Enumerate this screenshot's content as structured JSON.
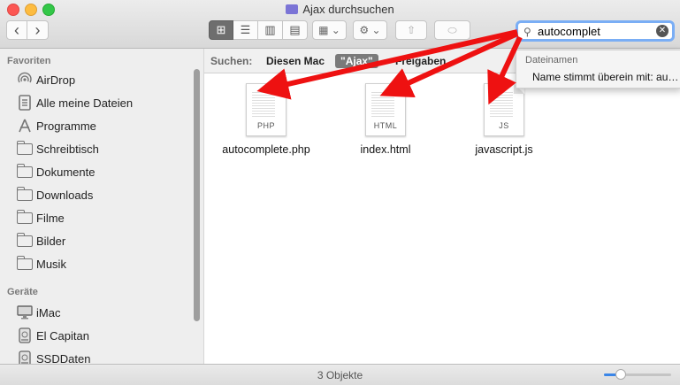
{
  "window": {
    "title": "Ajax durchsuchen",
    "search_value": "autocomplet"
  },
  "toolbar": {
    "back_glyph": "‹",
    "forward_glyph": "›",
    "view_icon_glyph": "⊞",
    "view_list_glyph": "☰",
    "view_column_glyph": "▥",
    "view_gallery_glyph": "▤",
    "arrange_glyph": "▦ ⌄",
    "action_glyph": "⚙ ⌄",
    "share_glyph": "⇧",
    "tag_glyph": "⬭",
    "search_glyph": "⚲",
    "clear_glyph": "✕"
  },
  "sidebar": {
    "favorites_header": "Favoriten",
    "favorites": [
      {
        "label": "AirDrop",
        "icon": "airdrop-icon"
      },
      {
        "label": "Alle meine Dateien",
        "icon": "all-files-icon"
      },
      {
        "label": "Programme",
        "icon": "applications-icon"
      },
      {
        "label": "Schreibtisch",
        "icon": "folder-icon"
      },
      {
        "label": "Dokumente",
        "icon": "folder-icon"
      },
      {
        "label": "Downloads",
        "icon": "folder-icon"
      },
      {
        "label": "Filme",
        "icon": "folder-icon"
      },
      {
        "label": "Bilder",
        "icon": "folder-icon"
      },
      {
        "label": "Musik",
        "icon": "folder-icon"
      }
    ],
    "devices_header": "Geräte",
    "devices": [
      {
        "label": "iMac",
        "icon": "imac-icon"
      },
      {
        "label": "El Capitan",
        "icon": "disk-icon"
      },
      {
        "label": "SSDDaten",
        "icon": "disk-icon"
      }
    ]
  },
  "scope_bar": {
    "label": "Suchen:",
    "this_mac": "Diesen Mac",
    "current_folder": "\"Ajax\"",
    "shared": "Freigaben"
  },
  "files": [
    {
      "name": "autocomplete.php",
      "ext": "PHP"
    },
    {
      "name": "index.html",
      "ext": "HTML"
    },
    {
      "name": "javascript.js",
      "ext": "JS"
    }
  ],
  "suggestions": {
    "header": "Dateinamen",
    "item": "Name stimmt überein mit: au…"
  },
  "status": {
    "count": "3 Objekte",
    "zoom_fraction": 0.25
  },
  "colors": {
    "search_focus": "#7aaef5",
    "annotation_arrow": "#ee1111",
    "slider_accent": "#3a86e8"
  }
}
